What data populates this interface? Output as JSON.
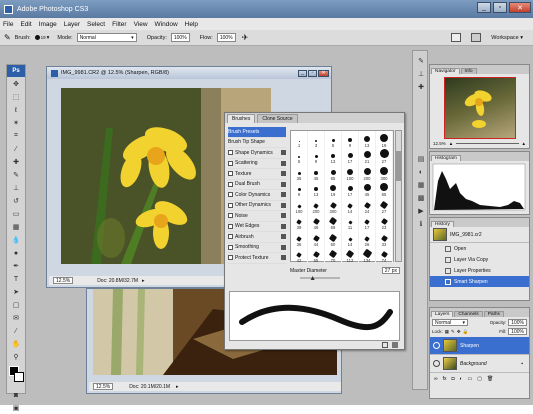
{
  "app": {
    "title": "Adobe Photoshop CS3"
  },
  "menu": [
    "File",
    "Edit",
    "Image",
    "Layer",
    "Select",
    "Filter",
    "View",
    "Window",
    "Help"
  ],
  "options": {
    "brush_label": "Brush:",
    "brush_size": "19",
    "mode_label": "Mode:",
    "mode_value": "Normal",
    "opacity_label": "Opacity:",
    "opacity_value": "100%",
    "flow_label": "Flow:",
    "flow_value": "100%",
    "workspace_label": "Workspace ▾"
  },
  "toolbox": {
    "logo": "Ps"
  },
  "doc1": {
    "title": "IMG_9981.CR2 @ 12.5% (Sharpen, RGB/8)",
    "zoom": "12.5%",
    "status": "Doc: 20.8M/32.7M"
  },
  "doc2": {
    "zoom": "12.5%",
    "status": "Doc: 20.1M/20.1M"
  },
  "brushes": {
    "tab_active": "Brushes",
    "tab_inactive": "Clone Source",
    "items": [
      {
        "label": "Brush Presets",
        "selected": true,
        "checkbox": false
      },
      {
        "label": "Brush Tip Shape",
        "selected": false,
        "checkbox": false
      },
      {
        "label": "Shape Dynamics",
        "selected": false,
        "checkbox": true
      },
      {
        "label": "Scattering",
        "selected": false,
        "checkbox": true
      },
      {
        "label": "Texture",
        "selected": false,
        "checkbox": true
      },
      {
        "label": "Dual Brush",
        "selected": false,
        "checkbox": true
      },
      {
        "label": "Color Dynamics",
        "selected": false,
        "checkbox": true
      },
      {
        "label": "Other Dynamics",
        "selected": false,
        "checkbox": true
      },
      {
        "label": "Noise",
        "selected": false,
        "checkbox": true
      },
      {
        "label": "Wet Edges",
        "selected": false,
        "checkbox": true
      },
      {
        "label": "Airbrush",
        "selected": false,
        "checkbox": true
      },
      {
        "label": "Smoothing",
        "selected": false,
        "checkbox": true
      },
      {
        "label": "Protect Texture",
        "selected": false,
        "checkbox": true
      }
    ],
    "presets": [
      {
        "n": "1",
        "s": 1
      },
      {
        "n": "3",
        "s": 2
      },
      {
        "n": "5",
        "s": 3
      },
      {
        "n": "9",
        "s": 4
      },
      {
        "n": "13",
        "s": 6
      },
      {
        "n": "19",
        "s": 8
      },
      {
        "n": "5",
        "s": 2
      },
      {
        "n": "9",
        "s": 3
      },
      {
        "n": "13",
        "s": 4
      },
      {
        "n": "17",
        "s": 5
      },
      {
        "n": "21",
        "s": 7
      },
      {
        "n": "27",
        "s": 9
      },
      {
        "n": "35",
        "s": 3
      },
      {
        "n": "45",
        "s": 4
      },
      {
        "n": "65",
        "s": 5
      },
      {
        "n": "100",
        "s": 6
      },
      {
        "n": "200",
        "s": 7
      },
      {
        "n": "300",
        "s": 8
      },
      {
        "n": "9",
        "s": 3
      },
      {
        "n": "13",
        "s": 4
      },
      {
        "n": "19",
        "s": 6
      },
      {
        "n": "17",
        "s": 5
      },
      {
        "n": "45",
        "s": 7
      },
      {
        "n": "65",
        "s": 8
      },
      {
        "n": "100",
        "s": 3
      },
      {
        "n": "200",
        "s": 4
      },
      {
        "n": "300",
        "s": 5
      },
      {
        "n": "14",
        "s": 4
      },
      {
        "n": "24",
        "s": 5
      },
      {
        "n": "27",
        "s": 6
      },
      {
        "n": "39",
        "s": 4
      },
      {
        "n": "46",
        "s": 5
      },
      {
        "n": "59",
        "s": 6
      },
      {
        "n": "11",
        "s": 3
      },
      {
        "n": "17",
        "s": 4
      },
      {
        "n": "23",
        "s": 5
      },
      {
        "n": "36",
        "s": 4
      },
      {
        "n": "44",
        "s": 5
      },
      {
        "n": "60",
        "s": 6
      },
      {
        "n": "14",
        "s": 3
      },
      {
        "n": "26",
        "s": 4
      },
      {
        "n": "33",
        "s": 5
      },
      {
        "n": "42",
        "s": 4
      },
      {
        "n": "55",
        "s": 5
      },
      {
        "n": "70",
        "s": 6
      },
      {
        "n": "112",
        "s": 6
      },
      {
        "n": "134",
        "s": 7
      },
      {
        "n": "74",
        "s": 5
      }
    ],
    "diameter_label": "Master Diameter",
    "diameter_value": "27 px"
  },
  "navigator": {
    "tab": "Navigator",
    "tab2": "Info",
    "zoom": "12.5%"
  },
  "histogram": {
    "tab": "Histogram"
  },
  "history": {
    "tab": "History",
    "items": [
      "IMG_9981.cr2",
      "Open",
      "Layer Via Copy",
      "Layer Properties",
      "Smart Sharpen"
    ]
  },
  "layers": {
    "tabs": [
      "Layers",
      "Channels",
      "Paths"
    ],
    "blend": "Normal",
    "opacity_label": "Opacity:",
    "opacity": "100%",
    "lock_label": "Lock:",
    "fill_label": "Fill:",
    "fill": "100%",
    "items": [
      {
        "name": "Sharpen",
        "selected": true
      },
      {
        "name": "Background",
        "selected": false
      }
    ]
  }
}
